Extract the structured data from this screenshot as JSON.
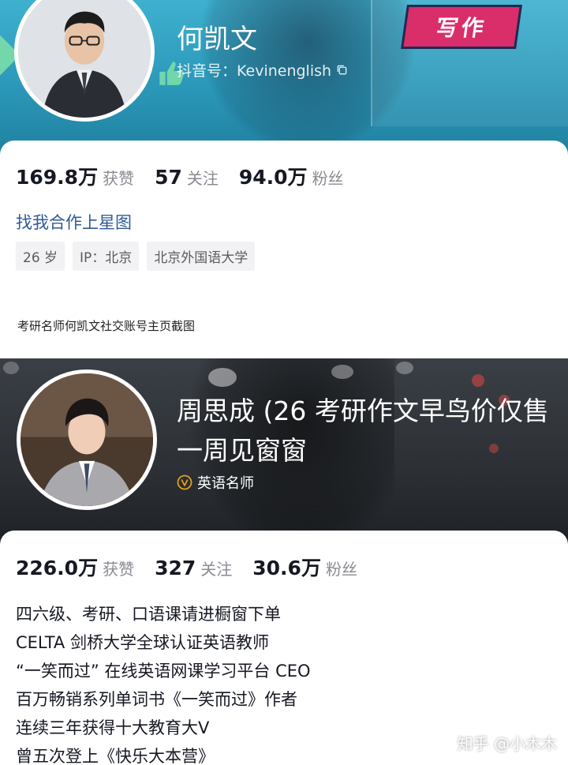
{
  "profile1": {
    "banner_tag": "写作",
    "name": "何凯文",
    "account_id": "抖音号：Kevinenglish",
    "stats": [
      {
        "value": "169.8万",
        "label": "获赞"
      },
      {
        "value": "57",
        "label": "关注"
      },
      {
        "value": "94.0万",
        "label": "粉丝"
      }
    ],
    "cta_link": "找我合作上星图",
    "chips": [
      "26 岁",
      "IP：北京",
      "北京外国语大学"
    ],
    "banner_color": "#3fb0cf"
  },
  "caption": "考研名师何凯文社交账号主页截图",
  "profile2": {
    "name": "周思成 (26 考研作文早鸟价仅售一周见窗窗",
    "verification": "英语名师",
    "stats": [
      {
        "value": "226.0万",
        "label": "获赞"
      },
      {
        "value": "327",
        "label": "关注"
      },
      {
        "value": "30.6万",
        "label": "粉丝"
      }
    ],
    "bio": [
      "四六级、考研、口语课请进橱窗下单",
      "CELTA 剑桥大学全球认证英语教师",
      "“一笑而过” 在线英语网课学习平台 CEO",
      "百万畅销系列单词书《一笑而过》作者",
      "连续三年获得十大教育大V",
      "曾五次登上《快乐大本营》"
    ],
    "verify_color": "#e0a020"
  },
  "watermark": "知乎 @小木木"
}
